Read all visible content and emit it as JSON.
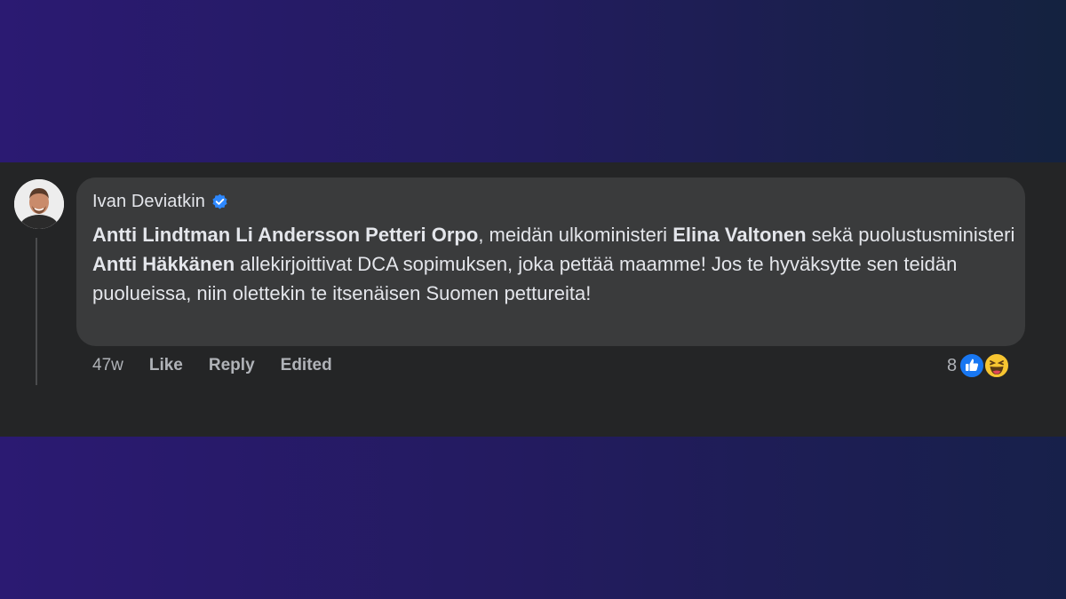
{
  "comment": {
    "author": "Ivan Deviatkin",
    "verified_icon": "verified-badge-icon",
    "segments": [
      {
        "text": "Antti Lindtman Li Andersson Petteri Orpo",
        "bold": true
      },
      {
        "text": ", meidän ulkoministeri ",
        "bold": false
      },
      {
        "text": "Elina Valtonen",
        "bold": true
      },
      {
        "text": " sekä puolustusministeri ",
        "bold": false
      },
      {
        "text": "Antti Häkkänen",
        "bold": true
      },
      {
        "text": " allekirjoittivat DCA sopimuksen, joka pettää maamme! Jos te hyväksytte sen teidän puolueissa, niin olettekin te itsenäisen Suomen pettureita!",
        "bold": false
      }
    ]
  },
  "actions": {
    "time": "47w",
    "like": "Like",
    "reply": "Reply",
    "edited": "Edited"
  },
  "reactions": {
    "count": "8",
    "icons": [
      "like-reaction-icon",
      "haha-reaction-icon"
    ]
  },
  "colors": {
    "panel": "#242526",
    "bubble": "#3a3b3c",
    "text": "#e4e6eb",
    "muted": "#b0b3b8",
    "accent": "#2d88ff"
  }
}
